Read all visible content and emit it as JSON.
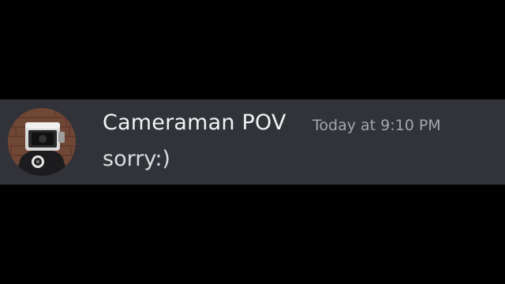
{
  "message": {
    "author": "Cameraman POV",
    "timestamp": "Today at 9:10 PM",
    "content": "sorry:)",
    "avatar_icon": "cameraman-avatar-icon"
  },
  "colors": {
    "page_background": "#000000",
    "message_background": "#313338",
    "author_color": "#f2f3f5",
    "timestamp_color": "#a3a6ad",
    "content_color": "#dbdee1"
  }
}
